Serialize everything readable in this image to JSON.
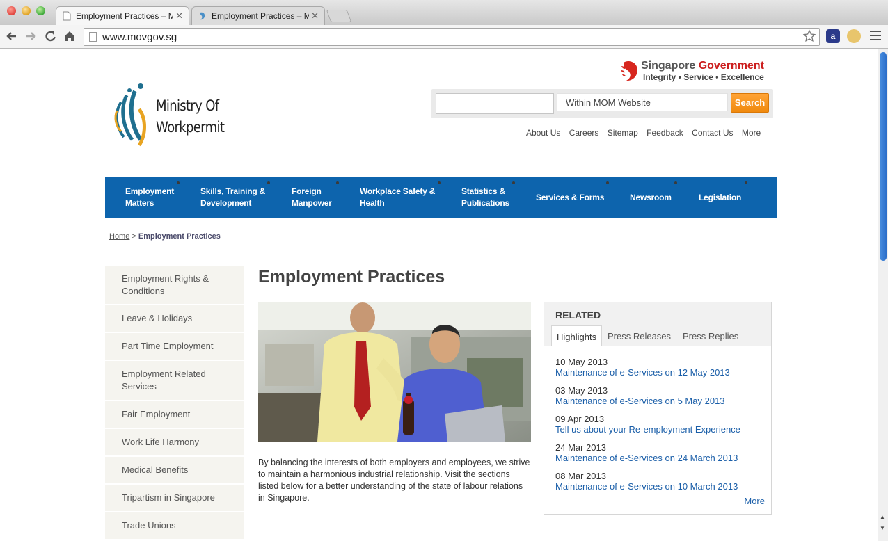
{
  "browser": {
    "tabs": [
      {
        "title": "Employment Practices – Mi",
        "active": true
      },
      {
        "title": "Employment Practices – Mi",
        "active": false
      }
    ],
    "url": "www.movgov.sg",
    "close_glyph": "✕",
    "extension_a_label": "a"
  },
  "header": {
    "gov_name_part1": "Singapore",
    "gov_name_part2": "Government",
    "gov_tagline": "Integrity • Service • Excellence",
    "ministry_line1": "Ministry Of",
    "ministry_line2": "Workpermit",
    "search": {
      "value": "",
      "scope": "Within MOM Website",
      "button": "Search"
    },
    "utility_links": [
      "About Us",
      "Careers",
      "Sitemap",
      "Feedback",
      "Contact Us",
      "More"
    ]
  },
  "nav": [
    {
      "line1": "Employment",
      "line2": "Matters"
    },
    {
      "line1": "Skills, Training &",
      "line2": "Development"
    },
    {
      "line1": "Foreign",
      "line2": "Manpower"
    },
    {
      "line1": "Workplace Safety &",
      "line2": "Health"
    },
    {
      "line1": "Statistics &",
      "line2": "Publications"
    },
    {
      "line1": "Services & Forms",
      "line2": ""
    },
    {
      "line1": "Newsroom",
      "line2": ""
    },
    {
      "line1": "Legislation",
      "line2": ""
    }
  ],
  "breadcrumb": {
    "home": "Home",
    "separator": ">",
    "current": "Employment Practices"
  },
  "sidebar": [
    "Employment Rights & Conditions",
    "Leave & Holidays",
    "Part Time Employment",
    "Employment Related Services",
    "Fair Employment",
    "Work Life Harmony",
    "Medical Benefits",
    "Tripartism in Singapore",
    "Trade Unions"
  ],
  "main": {
    "title": "Employment Practices",
    "intro": "By balancing the interests of both employers and employees, we strive to maintain a harmonious industrial relationship. Visit the sections listed below for a better understanding of the state of labour relations in Singapore."
  },
  "related": {
    "title": "RELATED",
    "tabs": [
      "Highlights",
      "Press Releases",
      "Press Replies"
    ],
    "active_tab": "Highlights",
    "items": [
      {
        "date": "10 May 2013",
        "title": "Maintenance of e-Services on 12 May 2013"
      },
      {
        "date": "03 May 2013",
        "title": "Maintenance of e-Services on 5 May 2013"
      },
      {
        "date": "09 Apr 2013",
        "title": "Tell us about your Re-employment Experience"
      },
      {
        "date": "24 Mar 2013",
        "title": "Maintenance of e-Services on 24 March 2013"
      },
      {
        "date": "08 Mar 2013",
        "title": "Maintenance of e-Services on 10 March 2013"
      }
    ],
    "more": "More"
  },
  "colors": {
    "nav_blue": "#0d64ad",
    "search_orange": "#f08a0e",
    "gov_red": "#cc1f1f",
    "link_blue": "#1a5ea8"
  }
}
